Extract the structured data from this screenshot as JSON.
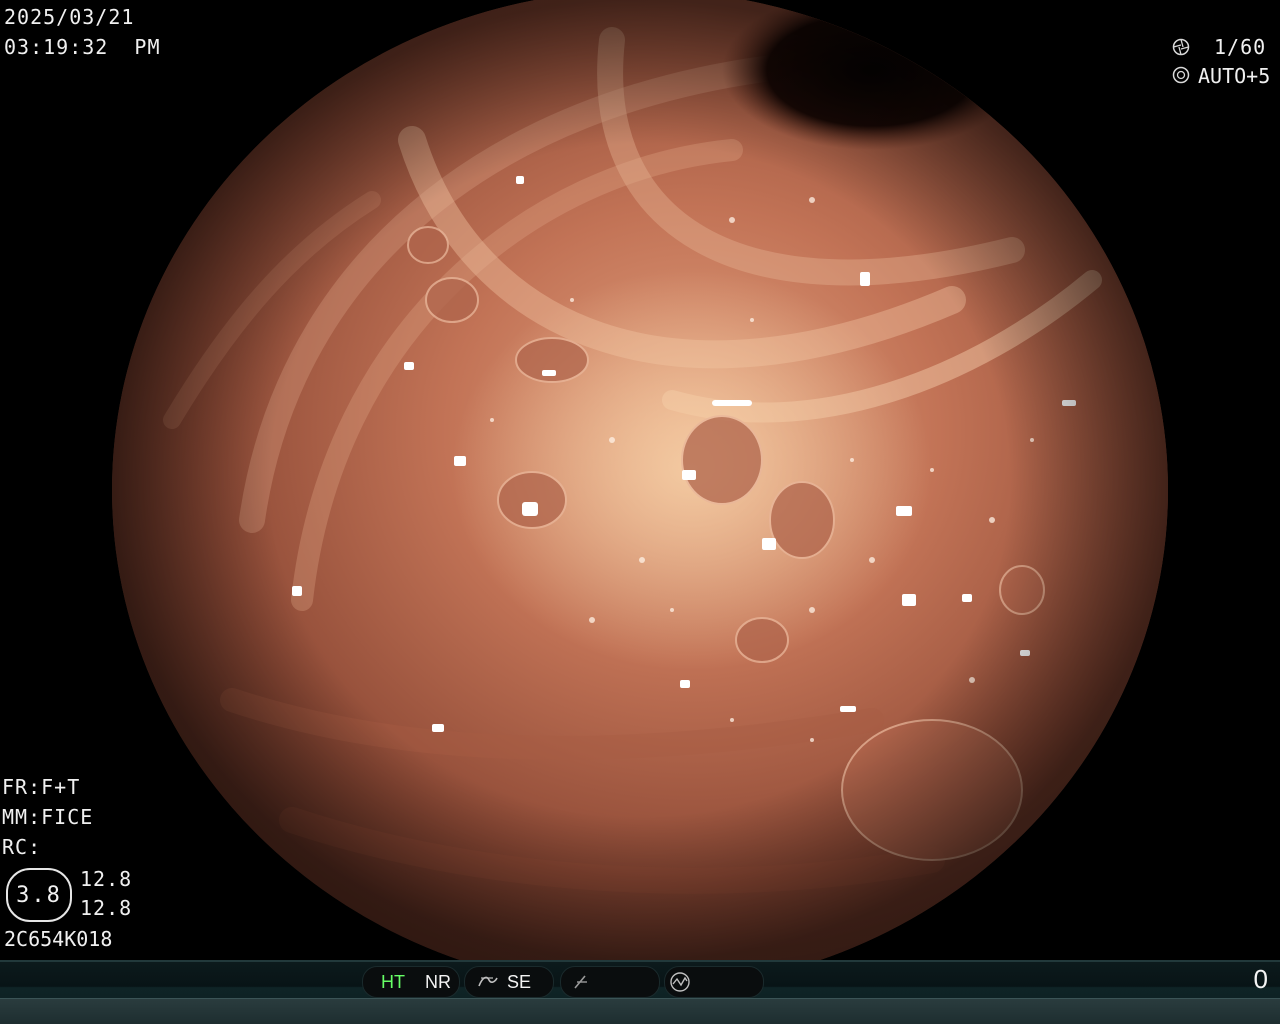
{
  "overlay": {
    "date": "2025/03/21",
    "time": "03:19:32  PM",
    "shutter": "1/60",
    "iris": "AUTO+5",
    "fr": "FR:F+T",
    "mm": "MM:FICE",
    "rc": "RC:",
    "ratio": "3.8",
    "value_1": "12.8",
    "value_2": "12.8",
    "scope_id": "2C654K018"
  },
  "status_bar": {
    "ht": "HT",
    "nr": "NR",
    "se": "SE",
    "counter": "0"
  },
  "icons": {
    "shutter": "aperture-icon",
    "iris": "iris-icon",
    "se": "curve-icon",
    "enhance": "slash-icon",
    "signal": "waveform-icon"
  },
  "colors": {
    "ht_accent": "#66ff66",
    "tissue": "#c27356"
  }
}
